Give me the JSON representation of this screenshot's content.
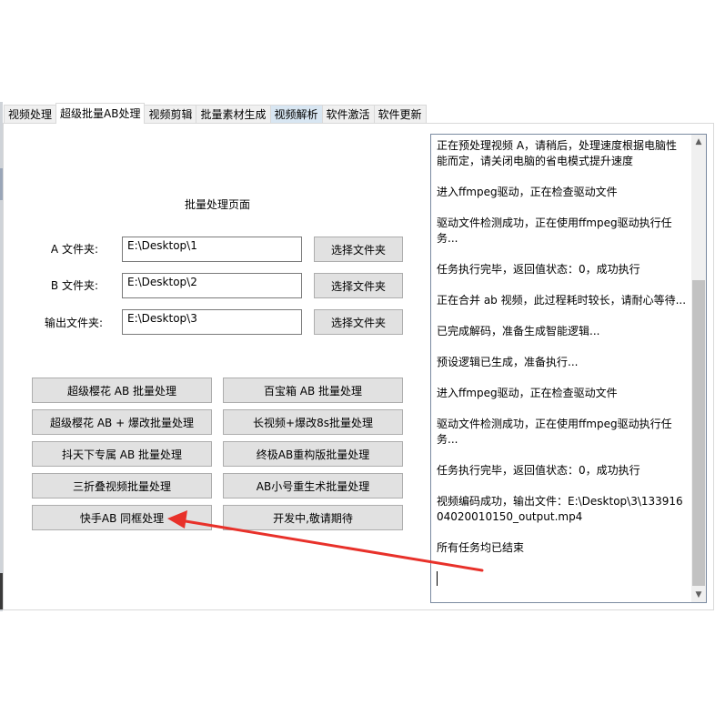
{
  "tabs": [
    {
      "label": "视频处理"
    },
    {
      "label": "超级批量AB处理"
    },
    {
      "label": "视频剪辑"
    },
    {
      "label": "批量素材生成"
    },
    {
      "label": "视频解析"
    },
    {
      "label": "软件激活"
    },
    {
      "label": "软件更新"
    }
  ],
  "active_tab": "超级批量AB处理",
  "page": {
    "title": "批量处理页面"
  },
  "folders": {
    "a": {
      "label": "A 文件夹:",
      "value": "E:\\Desktop\\1",
      "button": "选择文件夹"
    },
    "b": {
      "label": "B 文件夹:",
      "value": "E:\\Desktop\\2",
      "button": "选择文件夹"
    },
    "out": {
      "label": "输出文件夹:",
      "value": "E:\\Desktop\\3",
      "button": "选择文件夹"
    }
  },
  "actions": [
    {
      "label": "超级樱花 AB 批量处理"
    },
    {
      "label": "百宝箱 AB 批量处理"
    },
    {
      "label": "超级樱花 AB + 爆改批量处理"
    },
    {
      "label": "长视频+爆改8s批量处理"
    },
    {
      "label": "抖天下专属 AB 批量处理"
    },
    {
      "label": "终极AB重构版批量处理"
    },
    {
      "label": "三折叠视频批量处理"
    },
    {
      "label": "AB小号重生术批量处理"
    },
    {
      "label": "快手AB 同框处理"
    },
    {
      "label": "开发中,敬请期待"
    }
  ],
  "log": [
    "正在预处理视频 A，请稍后，处理速度根据电脑性能而定，请关闭电脑的省电模式提升速度",
    "",
    "进入ffmpeg驱动，正在检查驱动文件",
    "",
    "驱动文件检测成功，正在使用ffmpeg驱动执行任务...",
    "",
    "任务执行完毕，返回值状态：0，成功执行",
    "",
    "正在合并 ab 视频，此过程耗时较长，请耐心等待...",
    "",
    "已完成解码，准备生成智能逻辑...",
    "",
    "预设逻辑已生成，准备执行...",
    "",
    "进入ffmpeg驱动，正在检查驱动文件",
    "",
    "驱动文件检测成功，正在使用ffmpeg驱动执行任务...",
    "",
    "任务执行完毕，返回值状态：0，成功执行",
    "",
    "视频编码成功，输出文件：E:\\Desktop\\3\\13391604020010150_output.mp4",
    "",
    "所有任务均已结束"
  ],
  "colors": {
    "annotation_arrow": "#e8312a",
    "button_face": "#e1e1e1",
    "scroll_thumb": "#c2c2c2"
  }
}
